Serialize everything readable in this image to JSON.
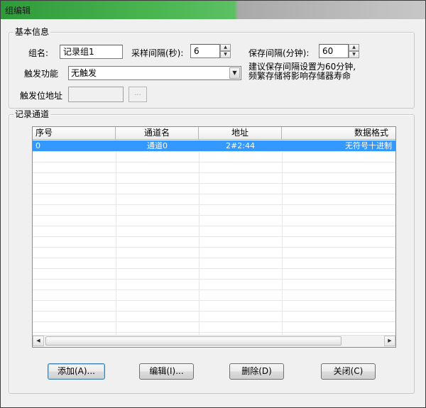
{
  "window": {
    "title": "组编辑"
  },
  "basic_info": {
    "group_title": "基本信息",
    "group_name_label": "组名:",
    "group_name_value": "记录组1",
    "sample_interval_label": "采样间隔(秒):",
    "sample_interval_value": "6",
    "save_interval_label": "保存间隔(分钟):",
    "save_interval_value": "60",
    "hint_line1": "建议保存间隔设置为60分钟,",
    "hint_line2": "频繁存储将影响存储器寿命",
    "trigger_function_label": "触发功能",
    "trigger_function_value": "无触发",
    "trigger_address_label": "触发位地址",
    "trigger_address_value": "",
    "browse_label": "..."
  },
  "channels": {
    "group_title": "记录通道",
    "columns": [
      "序号",
      "通道名",
      "地址",
      "数据格式"
    ],
    "rows": [
      {
        "index": "0",
        "name": "通道0",
        "address": "2#2:44",
        "format": "无符号十进制"
      }
    ]
  },
  "buttons": {
    "add": "添加(A)...",
    "edit": "编辑(I)...",
    "delete": "删除(D)",
    "close": "关闭(C)"
  },
  "colors": {
    "selection": "#3399ff",
    "titlebar_green": "#48b54f"
  },
  "icons": {
    "spin_up": "triangle-up",
    "spin_down": "triangle-down",
    "combo_arrow": "chevron-down",
    "scroll_left": "triangle-left",
    "scroll_right": "triangle-right"
  }
}
